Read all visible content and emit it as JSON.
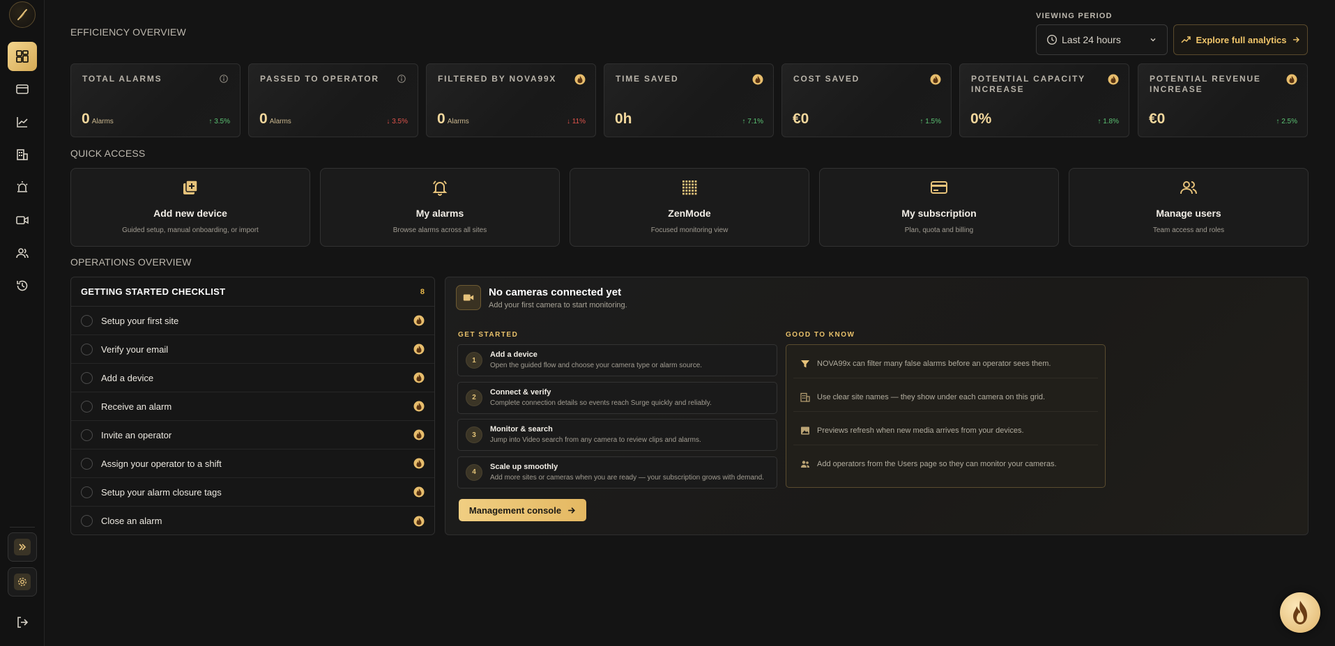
{
  "header": {
    "efficiency_title": "EFFICIENCY OVERVIEW",
    "viewing_period_label": "VIEWING PERIOD",
    "period_value": "Last 24 hours",
    "explore_label": "Explore full analytics"
  },
  "kpis": [
    {
      "title": "TOTAL ALARMS",
      "value": "0",
      "unit": "Alarms",
      "delta": "↑ 3.5%",
      "trend": "up",
      "icon": "info-icon"
    },
    {
      "title": "PASSED TO OPERATOR",
      "value": "0",
      "unit": "Alarms",
      "delta": "↓ 3.5%",
      "trend": "down",
      "icon": "info-icon"
    },
    {
      "title": "FILTERED BY NOVA99X",
      "value": "0",
      "unit": "Alarms",
      "delta": "↓ 11%",
      "trend": "down",
      "icon": "flame-badge-icon"
    },
    {
      "title": "TIME SAVED",
      "value": "0h",
      "unit": "",
      "delta": "↑ 7.1%",
      "trend": "up",
      "icon": "flame-badge-icon"
    },
    {
      "title": "COST SAVED",
      "value": "€0",
      "unit": "",
      "delta": "↑ 1.5%",
      "trend": "up",
      "icon": "flame-badge-icon"
    },
    {
      "title": "POTENTIAL CAPACITY INCREASE",
      "value": "0%",
      "unit": "",
      "delta": "↑ 1.8%",
      "trend": "up",
      "icon": "flame-badge-icon"
    },
    {
      "title": "POTENTIAL REVENUE INCREASE",
      "value": "€0",
      "unit": "",
      "delta": "↑ 2.5%",
      "trend": "up",
      "icon": "flame-badge-icon"
    }
  ],
  "quick_access": {
    "title": "QUICK ACCESS",
    "items": [
      {
        "title": "Add new device",
        "subtitle": "Guided setup, manual onboarding, or import",
        "icon": "add-device-icon"
      },
      {
        "title": "My alarms",
        "subtitle": "Browse alarms across all sites",
        "icon": "bell-icon"
      },
      {
        "title": "ZenMode",
        "subtitle": "Focused monitoring view",
        "icon": "grid-icon"
      },
      {
        "title": "My subscription",
        "subtitle": "Plan, quota and billing",
        "icon": "credit-card-icon"
      },
      {
        "title": "Manage users",
        "subtitle": "Team access and roles",
        "icon": "users-icon"
      }
    ]
  },
  "operations": {
    "title": "OPERATIONS OVERVIEW",
    "checklist": {
      "title": "GETTING STARTED CHECKLIST",
      "count": "8",
      "items": [
        "Setup your first site",
        "Verify your email",
        "Add a device",
        "Receive an alarm",
        "Invite an operator",
        "Assign your operator to a shift",
        "Setup your alarm closure tags",
        "Close an alarm"
      ]
    },
    "cameras": {
      "title": "No cameras connected yet",
      "subtitle": "Add your first camera to start monitoring.",
      "get_started_label": "GET STARTED",
      "good_to_know_label": "GOOD TO KNOW",
      "steps": [
        {
          "num": "1",
          "title": "Add a device",
          "desc": "Open the guided flow and choose your camera type or alarm source."
        },
        {
          "num": "2",
          "title": "Connect & verify",
          "desc": "Complete connection details so events reach Surge quickly and reliably."
        },
        {
          "num": "3",
          "title": "Monitor & search",
          "desc": "Jump into Video search from any camera to review clips and alarms."
        },
        {
          "num": "4",
          "title": "Scale up smoothly",
          "desc": "Add more sites or cameras when you are ready — your subscription grows with demand."
        }
      ],
      "tips": [
        {
          "icon": "filter-icon",
          "text": "NOVA99x can filter many false alarms before an operator sees them."
        },
        {
          "icon": "building-icon",
          "text": "Use clear site names — they show under each camera on this grid."
        },
        {
          "icon": "image-icon",
          "text": "Previews refresh when new media arrives from your devices."
        },
        {
          "icon": "users-icon",
          "text": "Add operators from the Users page so they can monitor your cameras."
        }
      ],
      "console_label": "Management console"
    }
  },
  "colors": {
    "accent": "#f0c56a",
    "up": "#5cc374",
    "down": "#e0544c"
  }
}
